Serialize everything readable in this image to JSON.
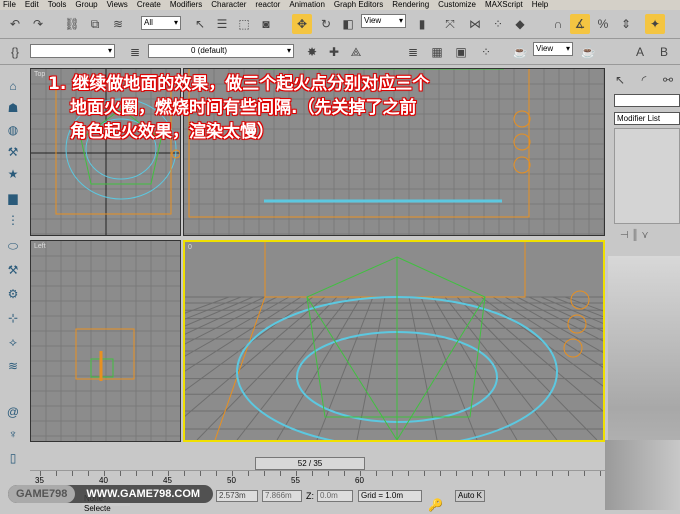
{
  "menu": [
    "File",
    "Edit",
    "Tools",
    "Group",
    "Views",
    "Create",
    "Modifiers",
    "Character",
    "reactor",
    "Animation",
    "Graph Editors",
    "Rendering",
    "Customize",
    "MAXScript",
    "Help"
  ],
  "toolbar": {
    "selection_filter": "All",
    "ref_coord": "View",
    "named_sel": "",
    "layer": "0 (default)",
    "render_view": "View"
  },
  "command_panel": {
    "name_field": "",
    "modifier_list": "Modifier List"
  },
  "viewports": {
    "top": "Top",
    "front": "",
    "left": "Left",
    "perspective": "0"
  },
  "time_slider": "52 / 35",
  "ruler_ticks": [
    "35",
    "40",
    "45",
    "50",
    "55",
    "60"
  ],
  "status": {
    "selection": "None Selecte",
    "x": "2.573m",
    "y": "7.866m",
    "z": "0.0m",
    "grid": "Grid = 1.0m",
    "auto_key": "Auto K"
  },
  "watermark": {
    "brand": "GAME798",
    "url": "WWW.GAME798.COM"
  },
  "annotation": [
    "1. 继续做地面的效果，做三个起火点分别对应三个",
    "地面火圈，燃烧时间有些间隔.（先关掉了之前",
    "角色起火效果，渲染太慢）"
  ]
}
